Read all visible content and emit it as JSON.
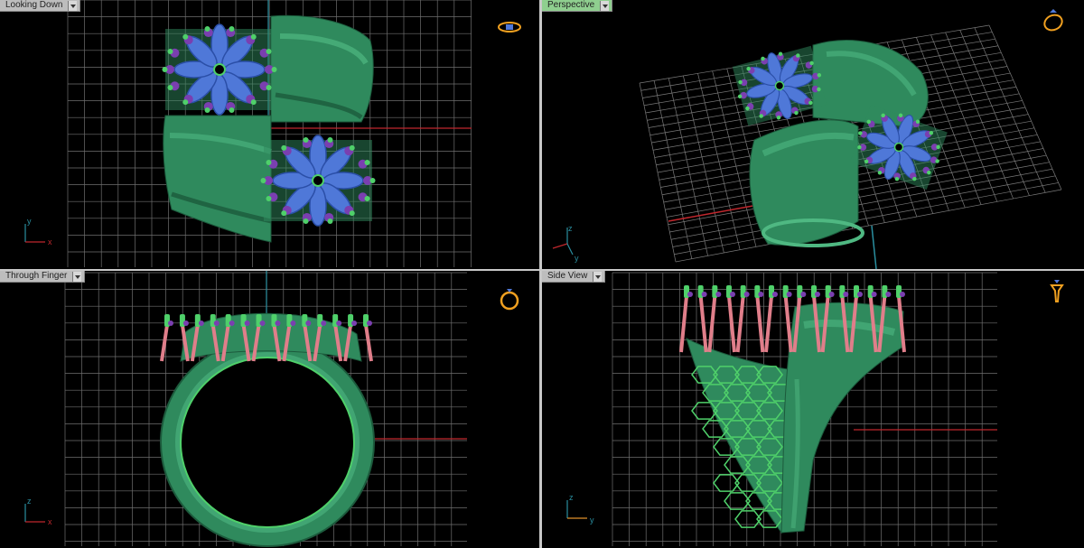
{
  "viewports": [
    {
      "id": "top_left",
      "label": "Looking Down",
      "active": false,
      "axes": [
        "y",
        "x"
      ]
    },
    {
      "id": "top_right",
      "label": "Perspective",
      "active": true,
      "axes": [
        "z",
        "y"
      ]
    },
    {
      "id": "bottom_left",
      "label": "Through Finger",
      "active": false,
      "axes": [
        "z",
        "x"
      ]
    },
    {
      "id": "bottom_right",
      "label": "Side View",
      "active": false,
      "axes": [
        "z",
        "y"
      ]
    }
  ],
  "colors": {
    "grid": "#6f6f6f",
    "grid_major": "#9a9a9a",
    "axis_x": "#c0272d",
    "axis_y": "#2a8fa0",
    "metal": "#2f8a5d",
    "metal_light": "#4fb882",
    "metal_dark": "#1c5a3c",
    "gem_blue": "#4f78d8",
    "gem_purple": "#7a3fb0",
    "prong_green": "#4fd06a",
    "prong_pink": "#e07e8a",
    "label_bg": "#bdbdbd",
    "label_active_bg": "#8fcf8f",
    "nav_icon": "#f0a020"
  },
  "icons": [
    "ring-top-view-icon",
    "ring-perspective-icon",
    "ring-front-view-icon",
    "ring-side-view-icon",
    "dropdown-arrow-icon"
  ]
}
